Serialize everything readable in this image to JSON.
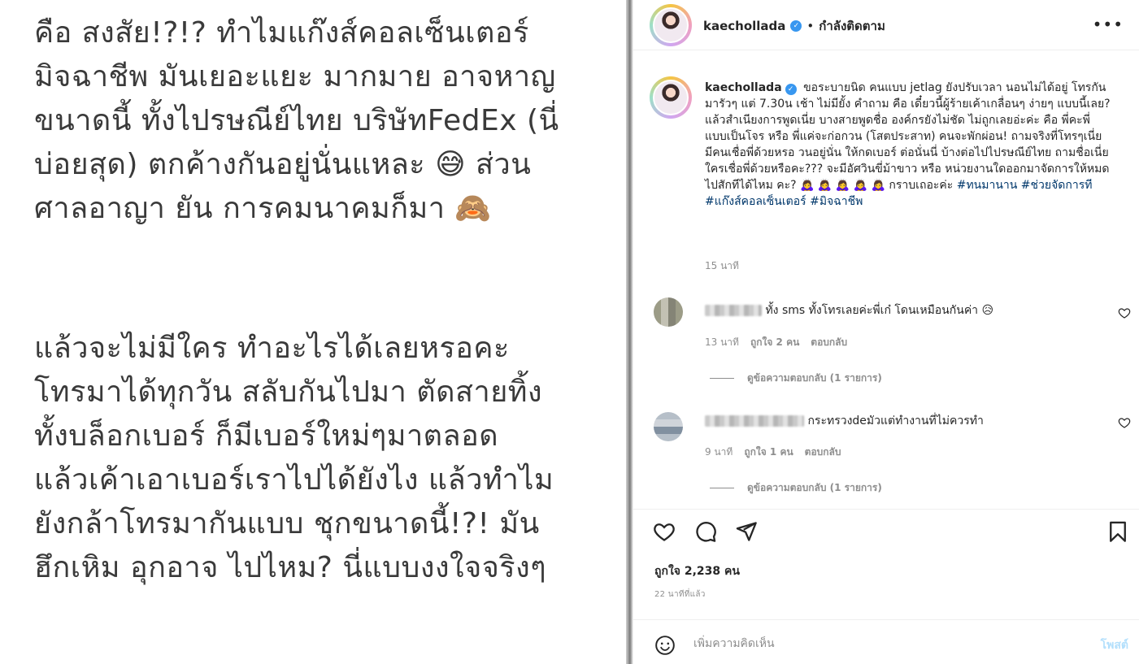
{
  "left_image": {
    "paragraph_1": "คือ สงสัย!?!? ทำไมแก๊งส์คอลเซ็นเตอร์\nมิจฉาชีพ มันเยอะแยะ มากมาย อาจหาญ\nขนาดนี้ ทั้งไปรษณีย์ไทย บริษัทFedEx (นี่\nบ่อยสุด) ตกค้างกันอยู่นั่นแหละ 😅 ส่วน\nศาลอาญา ยัน การคมนาคมก็มา 🙈",
    "paragraph_2": "แล้วจะไม่มีใคร ทำอะไรได้เลยหรอคะ\nโทรมาได้ทุกวัน สลับกันไปมา ตัดสายทิ้ง\nทั้งบล็อกเบอร์ ก็มีเบอร์ใหม่ๆมาตลอด\nแล้วเค้าเอาเบอร์เราไปได้ยังไง แล้วทำไม\nยังกล้าโทรมากันแบบ ชุกขนาดนี้!?! มัน\nฮึกเหิม อุกอาจ ไปไหม? นี่แบบงงใจจริงๆ"
  },
  "header": {
    "username": "kaechollada",
    "verified_mark": "✓",
    "separator": "•",
    "following_label": "กำลังติดตาม",
    "more_label": "•••"
  },
  "caption": {
    "username": "kaechollada",
    "text": "ขอระบายนิด คนแบบ jetlag ยังปรับเวลา นอนไม่ได้อยู่ โทรกันมารัวๆ แต่ 7.30น เช้า ไม่มียั้ง คำถาม คือ เดี๋ยวนี้ผู้ร้ายเค้าเกลื่อนๆ ง่ายๆ แบบนี้เลย? แล้วสำเนียงการพูดเนี่ย บางสายพูดชื่อ องค์กรยังไม่ชัด ไม่ถูกเลยอ่ะค่ะ คือ พี่คะพี่แบบเป็นโจร หรือ พี่แค่จะก่อกวน (โสตประสาท) คนจะพักผ่อน! ถามจริงที่โทรๆเนี่ย มีคนเชื่อพี่ด้วยหรอ วนอยู่นั่น ให้กดเบอร์ ต่อนั่นนี่ บ้างต่อไปไปรษณีย์ไทย ถามชื่อเนี่ยใครเชื่อพี่ด้วยหรือคะ??? จะมีอัศวินขี่ม้าขาว หรือ หน่วยงานใดออกมาจัดการให้หมดไปสักทีได้ไหม คะ? 🙇‍♀️ 🙇‍♀️ 🙇‍♀️ 🙇‍♀️ 🙇‍♀️ กราบเถอะค่ะ",
    "hashtags": [
      "#ทนมานาน",
      "#ช่วยจัดการที",
      "#แก๊งส์คอลเซ็นเตอร์",
      "#มิจฉาชีพ"
    ],
    "time": "15 นาที"
  },
  "comments": [
    {
      "text": "ทั้ง sms ทั้งโทรเลยค่ะพี่เก๋ โดนเหมือนกันค่า 😥",
      "time": "13 นาที",
      "likes": "ถูกใจ 2 คน",
      "reply_label": "ตอบกลับ",
      "view_replies": "ดูข้อความตอบกลับ (1 รายการ)"
    },
    {
      "text": "กระทรวงdeมัวแต่ทำงานที่ไม่ควรทำ",
      "time": "9 นาที",
      "likes": "ถูกใจ 1 คน",
      "reply_label": "ตอบกลับ",
      "view_replies": "ดูข้อความตอบกลับ (1 รายการ)"
    }
  ],
  "stats": {
    "likes": "ถูกใจ 2,238 คน",
    "posted": "22 นาทีที่แล้ว"
  },
  "comment_box": {
    "placeholder": "เพิ่มความคิดเห็น",
    "post_label": "โพสต์"
  },
  "colors": {
    "hashtag": "#00376b",
    "verified": "#3897f0",
    "post_button": "#b2dffc",
    "muted": "#8e8e8e"
  },
  "icons": [
    "more-icon",
    "heart-icon",
    "comment-icon",
    "share-icon",
    "bookmark-icon",
    "emoji-icon",
    "verified-icon"
  ]
}
